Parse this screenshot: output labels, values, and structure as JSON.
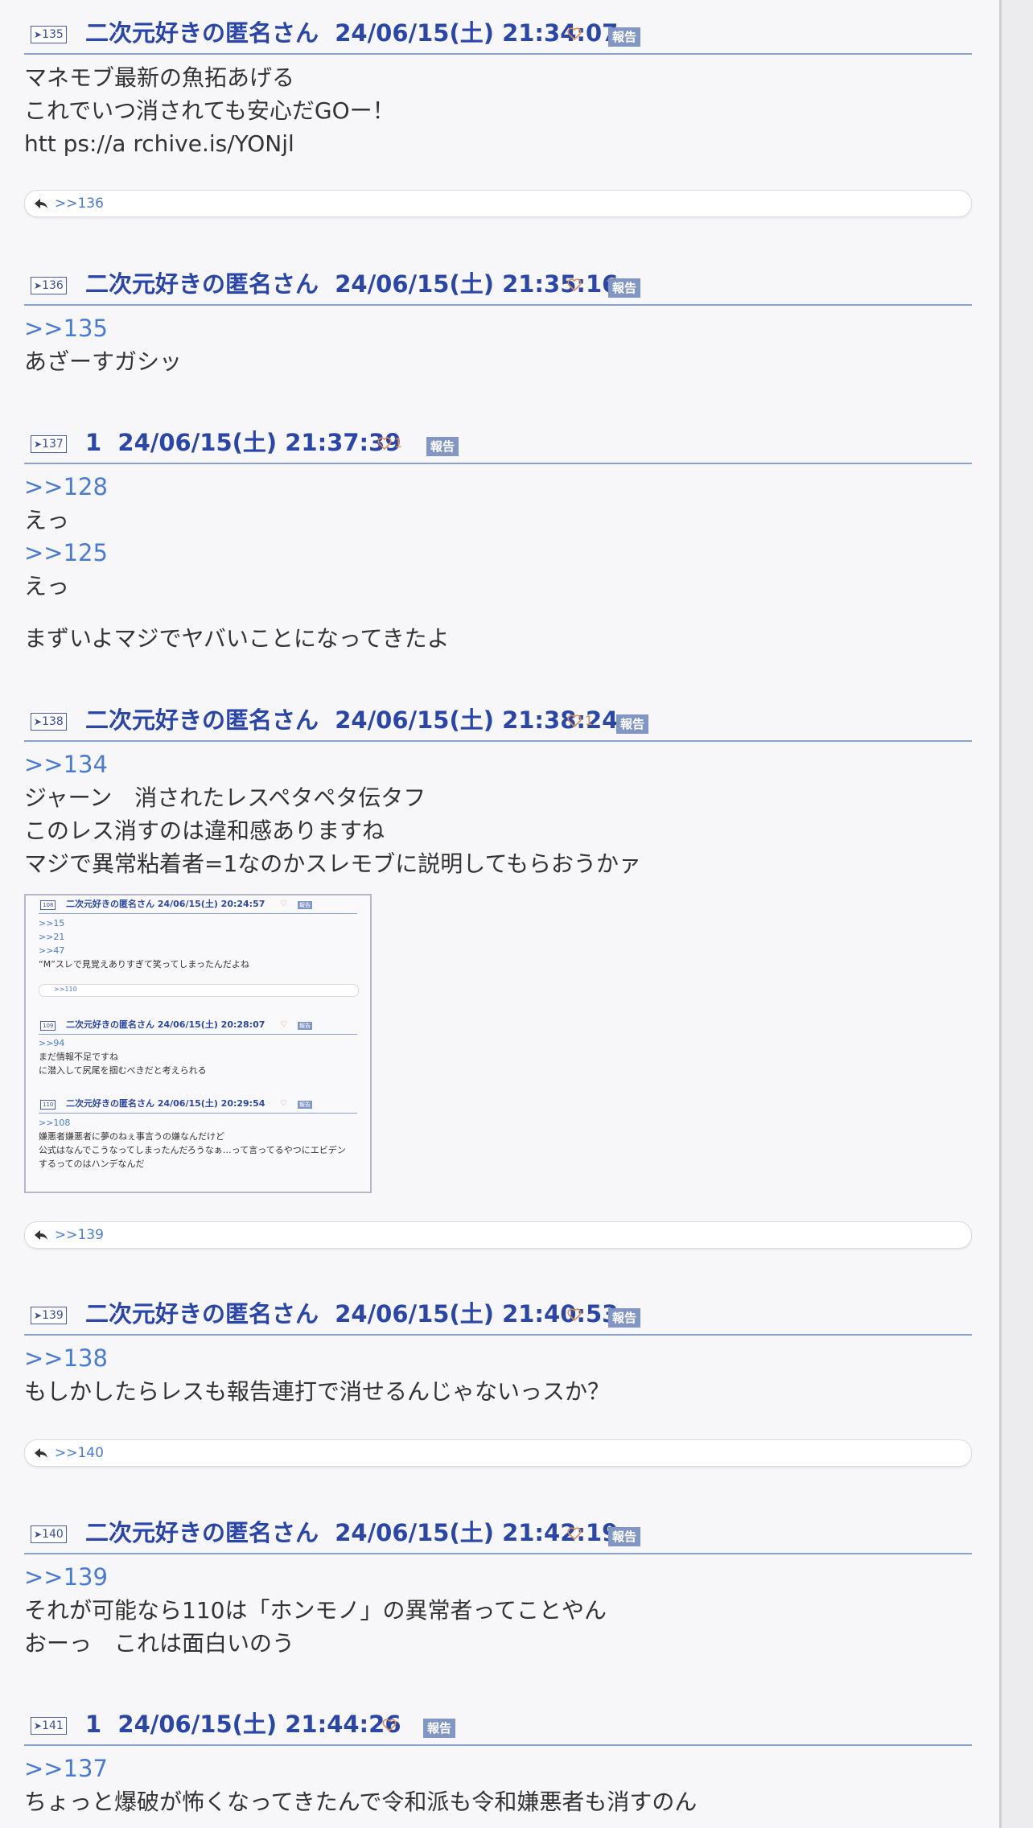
{
  "report_label": "報告",
  "posts": [
    {
      "number": "135",
      "name": "二次元好きの匿名さん",
      "date": "24/06/15(土) 21:34:07",
      "likes": "",
      "body": [
        "マネモブ最新の魚拓あげる",
        "これでいつ消されても安心だGOー！",
        "htt ps://a rchive.is/YONjl"
      ],
      "replies": ">>136"
    },
    {
      "number": "136",
      "name": "二次元好きの匿名さん",
      "date": "24/06/15(土) 21:35:16",
      "likes": "",
      "anchor": ">>135",
      "body": [
        "あざーすガシッ"
      ]
    },
    {
      "number": "137",
      "name": "1",
      "date": "24/06/15(土) 21:37:39",
      "likes": "1",
      "anchor1": ">>128",
      "body1": "えっ",
      "anchor2": ">>125",
      "body2": "えっ",
      "body3": "まずいよマジでヤバいことになってきたよ"
    },
    {
      "number": "138",
      "name": "二次元好きの匿名さん",
      "date": "24/06/15(土) 21:38:24",
      "likes": "1",
      "anchor": ">>134",
      "body": [
        "ジャーン　消されたレスペタペタ伝タフ",
        "このレス消すのは違和感ありますね",
        "マジで異常粘着者=1なのかスレモブに説明してもらおうかァ"
      ],
      "replies": ">>139",
      "screenshot": {
        "posts": [
          {
            "number": "108",
            "name": "二次元好きの匿名さん 24/06/15(土) 20:24:57",
            "anchors": [
              ">>15",
              ">>21",
              ">>47"
            ],
            "body": [
              "“M”スレで見覚えありすぎて笑ってしまったんだよね"
            ],
            "replies": ">>110"
          },
          {
            "number": "109",
            "name": "二次元好きの匿名さん 24/06/15(土) 20:28:07",
            "anchors": [
              ">>94"
            ],
            "body": [
              "まだ情報不足ですね",
              "に潜入して尻尾を掴むべきだと考えられる"
            ]
          },
          {
            "number": "110",
            "name": "二次元好きの匿名さん 24/06/15(土) 20:29:54",
            "anchors": [
              ">>108"
            ],
            "body": [
              "嫌悪者嫌悪者に夢のねぇ事言うの嫌なんだけど",
              "公式はなんでこうなってしまったんだろうなぁ…って言ってるやつにエビデン",
              "するってのはハンデなんだ"
            ]
          }
        ]
      }
    },
    {
      "number": "139",
      "name": "二次元好きの匿名さん",
      "date": "24/06/15(土) 21:40:53",
      "likes": "",
      "anchor": ">>138",
      "body": [
        "もしかしたらレスも報告連打で消せるんじゃないっスか？"
      ],
      "replies": ">>140"
    },
    {
      "number": "140",
      "name": "二次元好きの匿名さん",
      "date": "24/06/15(土) 21:42:19",
      "likes": "",
      "anchor": ">>139",
      "body": [
        "それが可能なら110は「ホンモノ」の異常者ってことやん",
        "おーっ　これは面白いのう"
      ]
    },
    {
      "number": "141",
      "name": "1",
      "date": "24/06/15(土) 21:44:26",
      "likes": "",
      "anchor": ">>137",
      "body": [
        "ちょっと爆破が怖くなってきたんで令和派も令和嫌悪者も消すのん"
      ]
    }
  ],
  "colors": {
    "name": "#2946a8",
    "anchor": "#4a7bd4",
    "report_bg": "#8296c4",
    "heart": "#e09050",
    "divider": "#8aa0cf"
  }
}
